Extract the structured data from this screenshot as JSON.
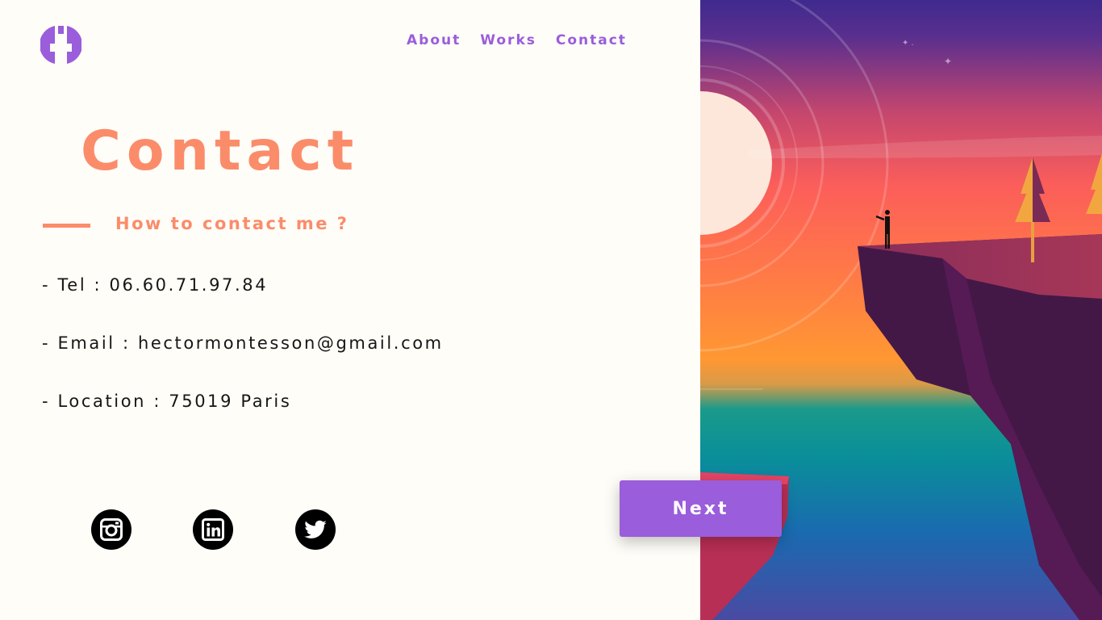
{
  "nav": {
    "items": [
      {
        "label": "About"
      },
      {
        "label": "Works"
      },
      {
        "label": "Contact"
      }
    ]
  },
  "main": {
    "title": "Contact",
    "subtitle": "How to contact me ?",
    "tel": "- Tel : 06.60.71.97.84",
    "email": "- Email : hectormontesson@gmail.com",
    "location": "- Location : 75019 Paris"
  },
  "socials": [
    {
      "icon": "instagram-icon"
    },
    {
      "icon": "linkedin-icon"
    },
    {
      "icon": "twitter-icon"
    }
  ],
  "next_button": {
    "label": "Next"
  },
  "colors": {
    "accent_purple": "#9a5ddb",
    "accent_salmon": "#fb8c6a",
    "background": "#fefdf8",
    "text": "#161616"
  }
}
